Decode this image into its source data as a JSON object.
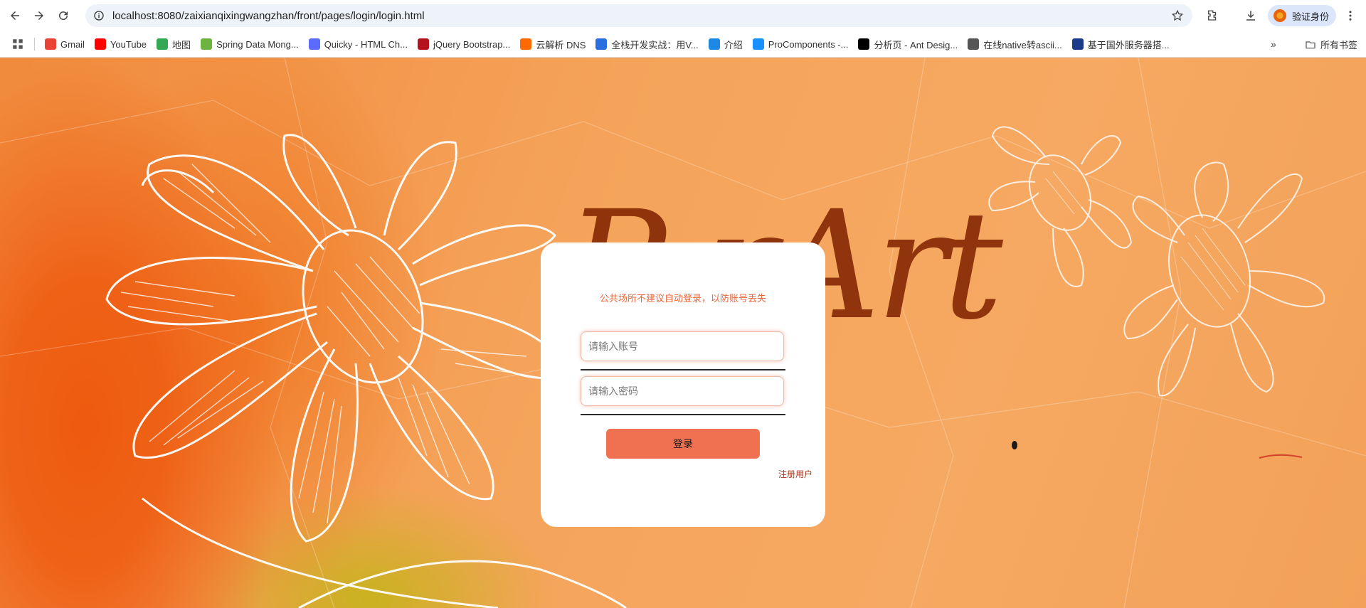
{
  "browser": {
    "url": "localhost:8080/zaixianqixingwangzhan/front/pages/login/login.html",
    "profile_label": "验证身份",
    "bookmarks": [
      {
        "label": "Gmail",
        "icon": "gmail-icon",
        "color": "#ea4335"
      },
      {
        "label": "YouTube",
        "icon": "youtube-icon",
        "color": "#ff0000"
      },
      {
        "label": "地图",
        "icon": "maps-icon",
        "color": "#34a853"
      },
      {
        "label": "Spring Data Mong...",
        "icon": "spring-icon",
        "color": "#6db33f"
      },
      {
        "label": "Quicky - HTML Ch...",
        "icon": "quicky-icon",
        "color": "#5b6bff"
      },
      {
        "label": "jQuery Bootstrap...",
        "icon": "jquery-icon",
        "color": "#b5121b"
      },
      {
        "label": "云解析 DNS",
        "icon": "aliyun-icon",
        "color": "#ff6a00"
      },
      {
        "label": "全栈开发实战：用V...",
        "icon": "m-icon",
        "color": "#2a6ee0"
      },
      {
        "label": "介绍",
        "icon": "globe-icon",
        "color": "#1e88e5"
      },
      {
        "label": "ProComponents -...",
        "icon": "antd-icon",
        "color": "#1890ff"
      },
      {
        "label": "分析页 - Ant Desig...",
        "icon": "pro-icon",
        "color": "#000000"
      },
      {
        "label": "在线native转ascii...",
        "icon": "world-icon",
        "color": "#555555"
      },
      {
        "label": "基于国外服务器搭...",
        "icon": "bird-icon",
        "color": "#1a3a8a"
      }
    ],
    "all_bookmarks_label": "所有书签"
  },
  "page": {
    "logo_text": "P    rArt",
    "notice": "公共场所不建议自动登录，以防账号丢失",
    "username_placeholder": "请输入账号",
    "password_placeholder": "请输入密码",
    "login_label": "登录",
    "register_label": "注册用户"
  }
}
